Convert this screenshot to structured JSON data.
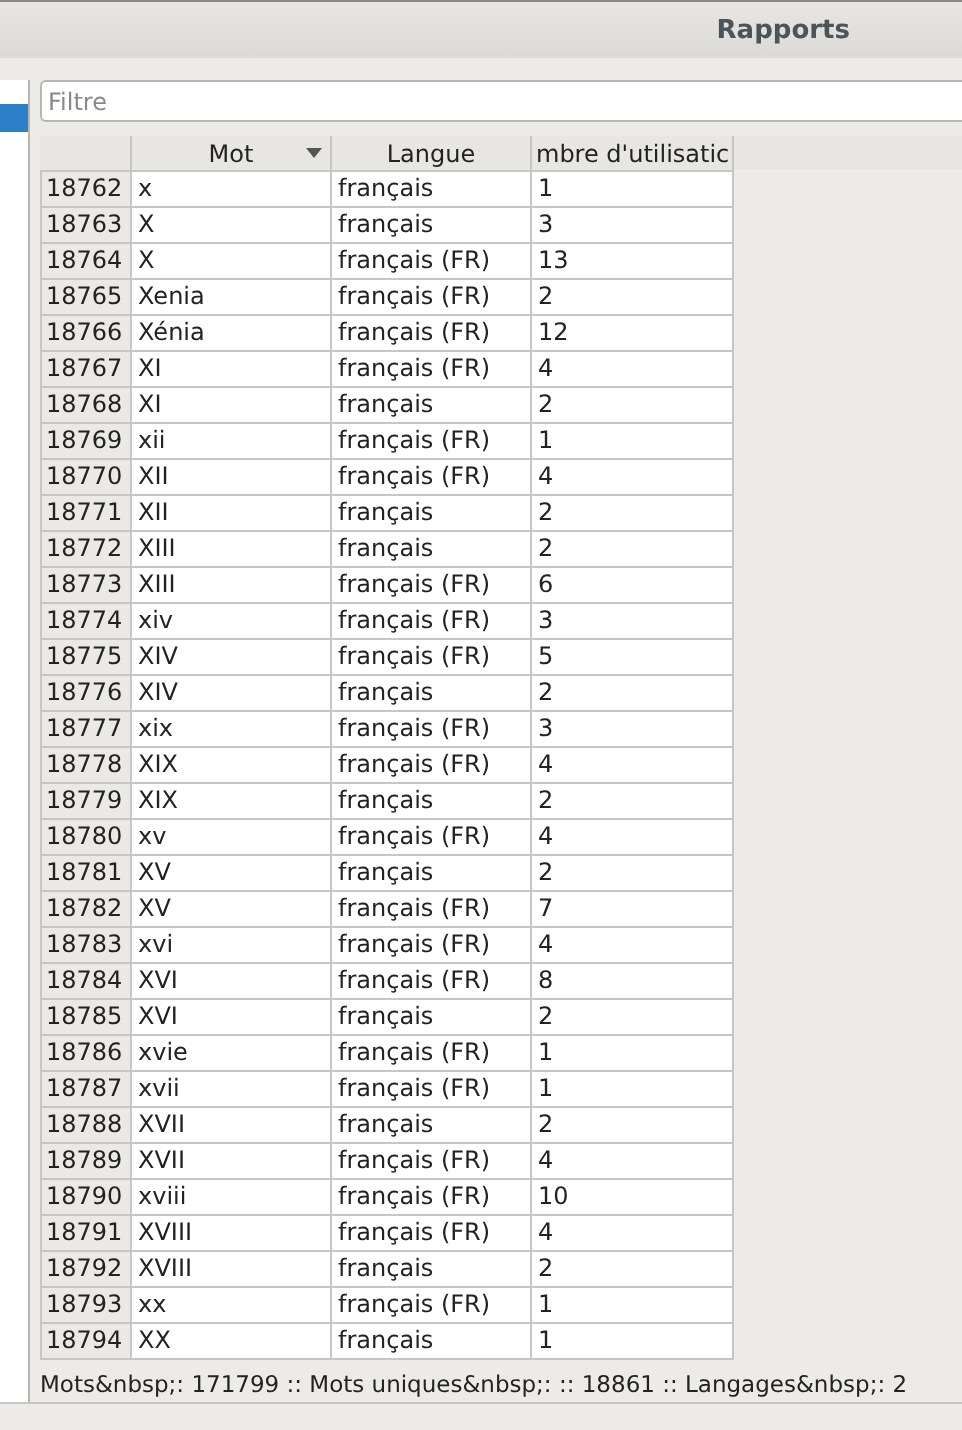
{
  "window": {
    "title": "Rapports"
  },
  "sidebar": {
    "items": [
      {
        "selected": true
      }
    ]
  },
  "filter": {
    "placeholder": "Filtre"
  },
  "table": {
    "columns": [
      "Mot",
      "Langue",
      "mbre d'utilisatic"
    ],
    "rows": [
      {
        "id": "18762",
        "word": "x",
        "language": "français",
        "count": "1"
      },
      {
        "id": "18763",
        "word": "X",
        "language": "français",
        "count": "3"
      },
      {
        "id": "18764",
        "word": "X",
        "language": "français (FR)",
        "count": "13"
      },
      {
        "id": "18765",
        "word": "Xenia",
        "language": "français (FR)",
        "count": "2"
      },
      {
        "id": "18766",
        "word": "Xénia",
        "language": "français (FR)",
        "count": "12"
      },
      {
        "id": "18767",
        "word": "XI",
        "language": "français (FR)",
        "count": "4"
      },
      {
        "id": "18768",
        "word": "XI",
        "language": "français",
        "count": "2"
      },
      {
        "id": "18769",
        "word": "xii",
        "language": "français (FR)",
        "count": "1"
      },
      {
        "id": "18770",
        "word": "XII",
        "language": "français (FR)",
        "count": "4"
      },
      {
        "id": "18771",
        "word": "XII",
        "language": "français",
        "count": "2"
      },
      {
        "id": "18772",
        "word": "XIII",
        "language": "français",
        "count": "2"
      },
      {
        "id": "18773",
        "word": "XIII",
        "language": "français (FR)",
        "count": "6"
      },
      {
        "id": "18774",
        "word": "xiv",
        "language": "français (FR)",
        "count": "3"
      },
      {
        "id": "18775",
        "word": "XIV",
        "language": "français (FR)",
        "count": "5"
      },
      {
        "id": "18776",
        "word": "XIV",
        "language": "français",
        "count": "2"
      },
      {
        "id": "18777",
        "word": "xix",
        "language": "français (FR)",
        "count": "3"
      },
      {
        "id": "18778",
        "word": "XIX",
        "language": "français (FR)",
        "count": "4"
      },
      {
        "id": "18779",
        "word": "XIX",
        "language": "français",
        "count": "2"
      },
      {
        "id": "18780",
        "word": "xv",
        "language": "français (FR)",
        "count": "4"
      },
      {
        "id": "18781",
        "word": "XV",
        "language": "français",
        "count": "2"
      },
      {
        "id": "18782",
        "word": "XV",
        "language": "français (FR)",
        "count": "7"
      },
      {
        "id": "18783",
        "word": "xvi",
        "language": "français (FR)",
        "count": "4"
      },
      {
        "id": "18784",
        "word": "XVI",
        "language": "français (FR)",
        "count": "8"
      },
      {
        "id": "18785",
        "word": "XVI",
        "language": "français",
        "count": "2"
      },
      {
        "id": "18786",
        "word": "xvie",
        "language": "français (FR)",
        "count": "1"
      },
      {
        "id": "18787",
        "word": "xvii",
        "language": "français (FR)",
        "count": "1"
      },
      {
        "id": "18788",
        "word": "XVII",
        "language": "français",
        "count": "2"
      },
      {
        "id": "18789",
        "word": "XVII",
        "language": "français (FR)",
        "count": "4"
      },
      {
        "id": "18790",
        "word": "xviii",
        "language": "français (FR)",
        "count": "10"
      },
      {
        "id": "18791",
        "word": "XVIII",
        "language": "français (FR)",
        "count": "4"
      },
      {
        "id": "18792",
        "word": "XVIII",
        "language": "français",
        "count": "2"
      },
      {
        "id": "18793",
        "word": "xx",
        "language": "français (FR)",
        "count": "1"
      },
      {
        "id": "18794",
        "word": "XX",
        "language": "français",
        "count": "1"
      }
    ]
  },
  "status_bar": "Mots&nbsp;: 171799 :: Mots uniques&nbsp;: :: 18861 :: Langages&nbsp;: 2"
}
